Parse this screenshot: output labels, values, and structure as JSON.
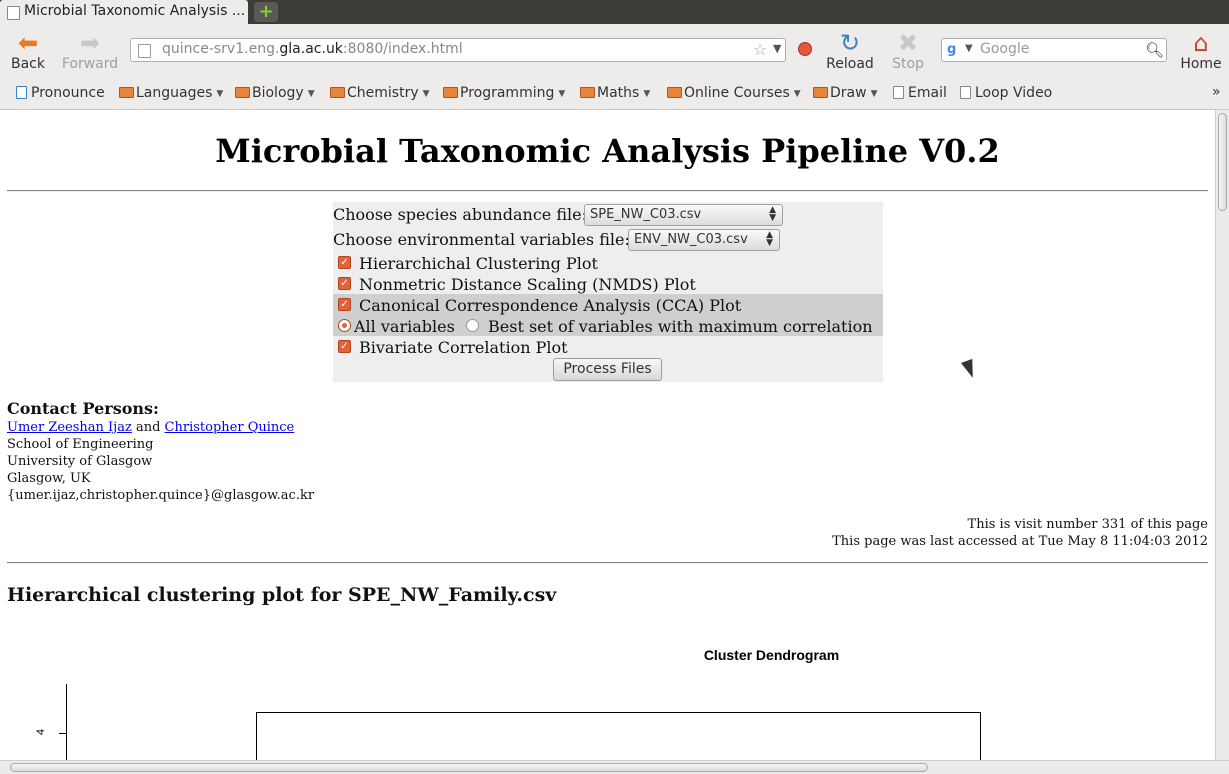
{
  "browser": {
    "tab_title": "Microbial Taxonomic Analysis ...",
    "new_tab": "+",
    "nav": {
      "back": "Back",
      "forward": "Forward",
      "reload": "Reload",
      "stop": "Stop",
      "home": "Home"
    },
    "url_prefix": "quince-srv1.eng.",
    "url_domain": "gla.ac.uk",
    "url_suffix": ":8080/index.html",
    "search_placeholder": "Google",
    "bookmarks": [
      {
        "label": "Pronounce",
        "type": "link"
      },
      {
        "label": "Languages",
        "type": "folder"
      },
      {
        "label": "Biology",
        "type": "folder"
      },
      {
        "label": "Chemistry",
        "type": "folder"
      },
      {
        "label": "Programming",
        "type": "folder"
      },
      {
        "label": "Maths",
        "type": "folder"
      },
      {
        "label": "Online Courses",
        "type": "folder"
      },
      {
        "label": "Draw",
        "type": "folder"
      },
      {
        "label": "Email",
        "type": "link"
      },
      {
        "label": "Loop Video",
        "type": "link"
      }
    ]
  },
  "page": {
    "title": "Microbial Taxonomic Analysis Pipeline V0.2",
    "form": {
      "species_label": "Choose species abundance file:",
      "species_value": "SPE_NW_C03.csv",
      "env_label": "Choose environmental variables file:",
      "env_value": "ENV_NW_C03.csv",
      "opt_hier": "Hierarchichal Clustering Plot",
      "opt_nmds": "Nonmetric Distance Scaling (NMDS) Plot",
      "opt_cca": "Canonical Correspondence Analysis (CCA) Plot",
      "radio_all": "All variables",
      "radio_best": "Best set of variables with maximum correlation",
      "opt_bivar": "Bivariate Correlation Plot",
      "submit": "Process Files"
    },
    "contact": {
      "heading": "Contact Persons:",
      "person1": "Umer Zeeshan Ijaz",
      "and": "and",
      "person2": "Christopher Quince",
      "line1": "School of Engineering",
      "line2": "University of Glasgow",
      "line3": "Glasgow, UK",
      "emails": "{umer.ijaz,christopher.quince}@glasgow.ac.kr"
    },
    "visits": {
      "count_text": "This is visit number 331 of this page",
      "accessed_text": "This page was last accessed at Tue May 8 11:04:03 2012"
    },
    "section_title": "Hierarchical clustering plot for SPE_NW_Family.csv",
    "plot": {
      "title": "Cluster Dendrogram",
      "y_tick": "4"
    }
  }
}
